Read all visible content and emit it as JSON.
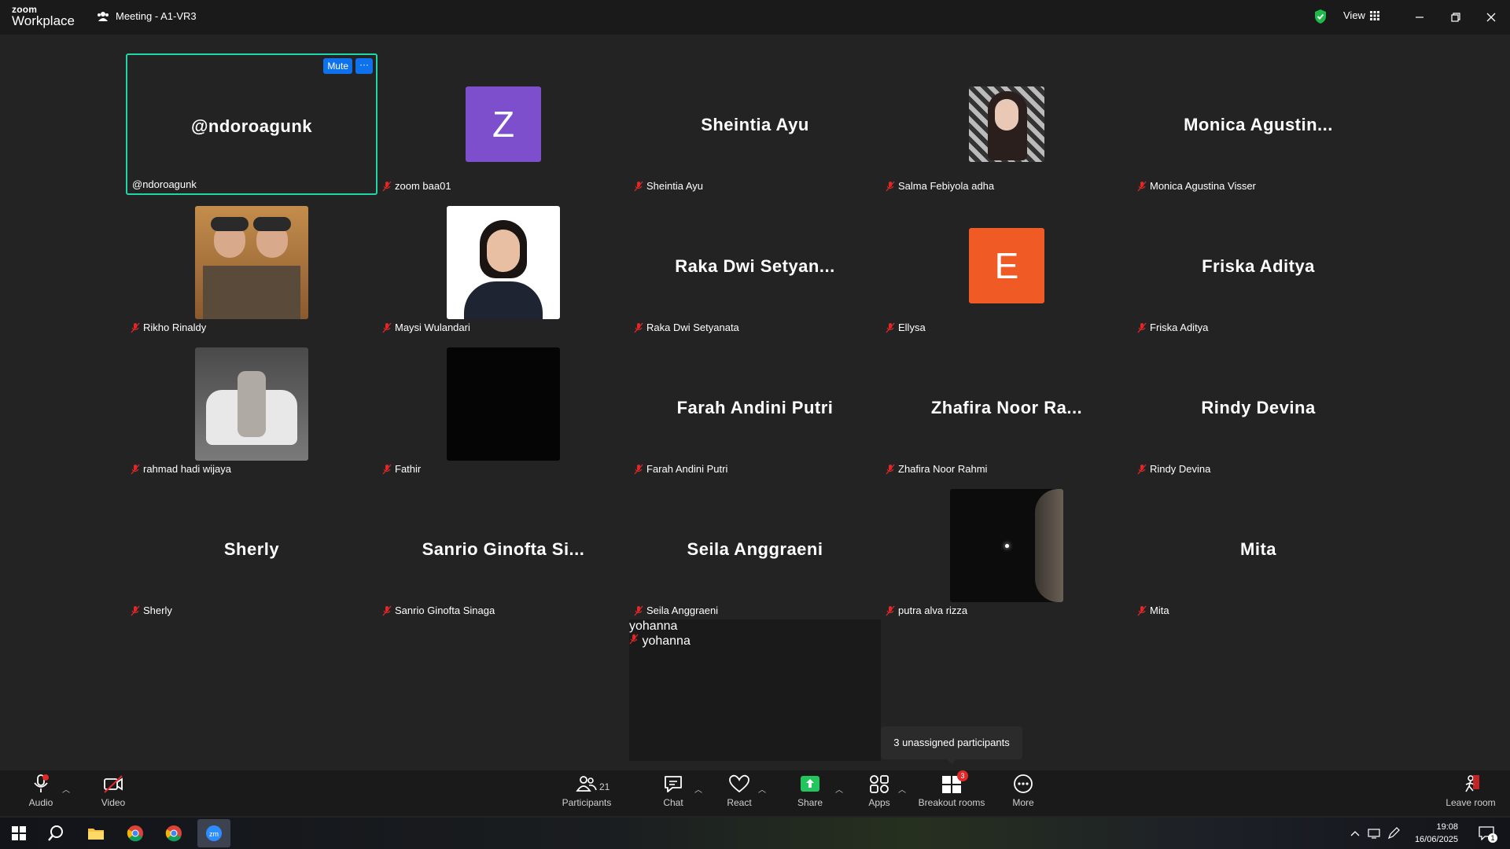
{
  "app": {
    "logo_line1": "zoom",
    "logo_line2": "Workplace",
    "meeting_title": "Meeting - A1-VR3",
    "view_label": "View"
  },
  "active_tile": {
    "mute_label": "Mute",
    "more_label": "···"
  },
  "tiles": [
    {
      "display": "@ndoroagunk",
      "label": "@ndoroagunk",
      "kind": "name",
      "active": true,
      "muted": false
    },
    {
      "display": "Z",
      "label": "zoom baa01",
      "kind": "letter",
      "color": "#7d4fcc",
      "muted": true
    },
    {
      "display": "Sheintia Ayu",
      "label": "Sheintia Ayu",
      "kind": "name",
      "muted": true
    },
    {
      "display": "",
      "label": "Salma Febiyola adha",
      "kind": "photo-portrait",
      "muted": true
    },
    {
      "display": "Monica  Agustin...",
      "label": "Monica Agustina Visser",
      "kind": "name",
      "muted": true
    },
    {
      "display": "",
      "label": "Rikho Rinaldy",
      "kind": "photo-two",
      "muted": true
    },
    {
      "display": "",
      "label": "Maysi Wulandari",
      "kind": "photo-profile",
      "muted": true
    },
    {
      "display": "Raka  Dwi  Setyan...",
      "label": "Raka Dwi Setyanata",
      "kind": "name",
      "muted": true
    },
    {
      "display": "E",
      "label": "Ellysa",
      "kind": "letter",
      "color": "#f05a24",
      "muted": true
    },
    {
      "display": "Friska Aditya",
      "label": "Friska Aditya",
      "kind": "name",
      "muted": true
    },
    {
      "display": "",
      "label": "rahmad hadi wijaya",
      "kind": "photo-car",
      "muted": true
    },
    {
      "display": "",
      "label": "Fathir",
      "kind": "photo-black",
      "muted": true
    },
    {
      "display": "Farah Andini Putri",
      "label": "Farah Andini Putri",
      "kind": "name",
      "muted": true
    },
    {
      "display": "Zhafira  Noor  Ra...",
      "label": "Zhafira Noor Rahmi",
      "kind": "name",
      "muted": true
    },
    {
      "display": "Rindy Devina",
      "label": "Rindy Devina",
      "kind": "name",
      "muted": true
    },
    {
      "display": "Sherly",
      "label": "Sherly",
      "kind": "name",
      "muted": true
    },
    {
      "display": "Sanrio  Ginofta  Si...",
      "label": "Sanrio Ginofta Sinaga",
      "kind": "name",
      "muted": true
    },
    {
      "display": "Seila Anggraeni",
      "label": "Seila Anggraeni",
      "kind": "name",
      "muted": true
    },
    {
      "display": "",
      "label": "putra alva rizza",
      "kind": "photo-night",
      "muted": true
    },
    {
      "display": "Mita",
      "label": "Mita",
      "kind": "name",
      "muted": true
    }
  ],
  "extra_tile": {
    "display": "yohanna",
    "label": "yohanna"
  },
  "tooltip": "3 unassigned participants",
  "toolbar": {
    "audio": "Audio",
    "video": "Video",
    "participants": "Participants",
    "participants_count": "21",
    "chat": "Chat",
    "react": "React",
    "share": "Share",
    "apps": "Apps",
    "breakout": "Breakout rooms",
    "breakout_badge": "3",
    "more": "More",
    "leave": "Leave room"
  },
  "taskbar": {
    "time": "19:08",
    "date": "16/06/2025",
    "notif_count": "1"
  },
  "colors": {
    "accent_blue": "#0e72ed",
    "active_border": "#1fd6a7",
    "share_green": "#22c55e",
    "mute_red": "#e02828"
  }
}
